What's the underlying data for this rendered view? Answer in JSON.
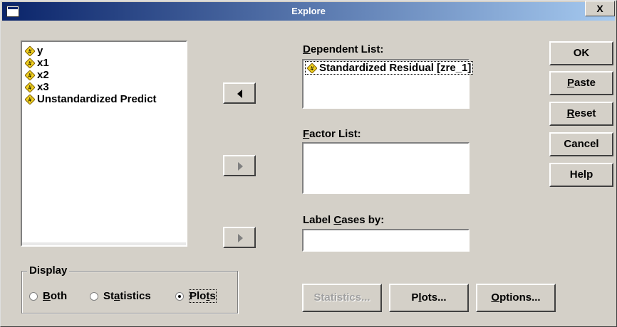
{
  "window": {
    "title": "Explore",
    "close_label": "X"
  },
  "variables": [
    "y",
    "x1",
    "x2",
    "x3",
    "Unstandardized Predict"
  ],
  "dependent_list": {
    "label_pre": "",
    "label_ul": "D",
    "label_post": "ependent List:",
    "items": [
      "Standardized Residual [zre_1]"
    ]
  },
  "factor_list": {
    "label_ul": "F",
    "label_post": "actor List:"
  },
  "label_cases": {
    "label_pre": "Label ",
    "label_ul": "C",
    "label_post": "ases by:"
  },
  "buttons": {
    "ok": "OK",
    "paste_ul": "P",
    "paste_rest": "aste",
    "reset_ul": "R",
    "reset_rest": "eset",
    "cancel": "Cancel",
    "help": "Help",
    "statistics": "Statistics...",
    "plots_pre": "P",
    "plots_ul": "l",
    "plots_rest": "ots...",
    "options_ul": "O",
    "options_rest": "ptions..."
  },
  "display": {
    "legend": "Display",
    "both_ul": "B",
    "both_rest": "oth",
    "stats_pre": "St",
    "stats_ul": "a",
    "stats_rest": "tistics",
    "plots_pre": "Plo",
    "plots_ul": "t",
    "plots_rest": "s",
    "selected": "Plots"
  }
}
